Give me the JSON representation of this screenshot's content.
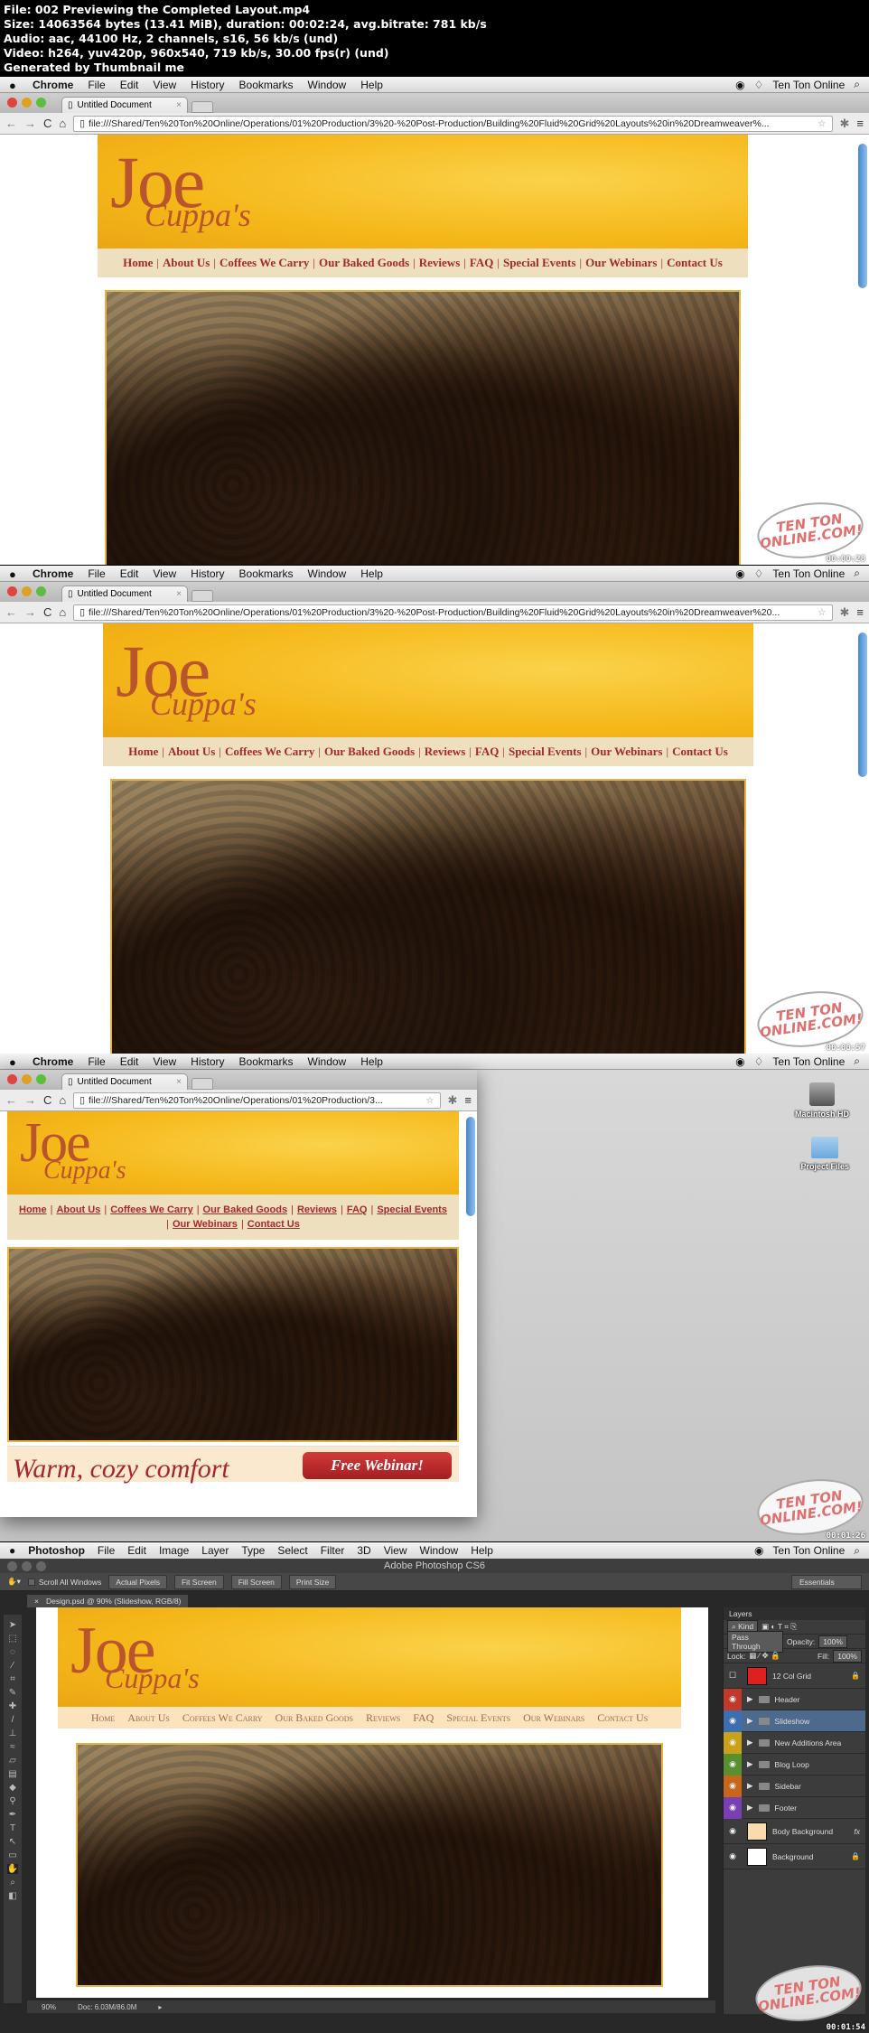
{
  "header": {
    "line1": "File: 002 Previewing the Completed Layout.mp4",
    "line2": "Size: 14063564 bytes (13.41 MiB), duration: 00:02:24, avg.bitrate: 781 kb/s",
    "line3": "Audio: aac, 44100 Hz, 2 channels, s16, 56 kb/s (und)",
    "line4": "Video: h264, yuv420p, 960x540, 719 kb/s, 30.00 fps(r) (und)",
    "line5": "Generated by Thumbnail me"
  },
  "mac_menu": {
    "app": "Chrome",
    "items": [
      "File",
      "Edit",
      "View",
      "History",
      "Bookmarks",
      "Window",
      "Help"
    ],
    "user": "Ten Ton Online"
  },
  "browser": {
    "tab_title": "Untitled Document",
    "tab_close": "×",
    "url_full": "file:///Shared/Ten%20Ton%20Online/Operations/01%20Production/3%20-%20Post-Production/Building%20Fluid%20Grid%20Layouts%20in%20Dreamweaver%...",
    "url_full2": "file:///Shared/Ten%20Ton%20Online/Operations/01%20Production/3%20-%20Post-Production/Building%20Fluid%20Grid%20Layouts%20in%20Dreamweaver%20...",
    "url_short": "file:///Shared/Ten%20Ton%20Online/Operations/01%20Production/3..."
  },
  "site": {
    "logo_main": "Joe",
    "logo_sub": "Cuppa's",
    "nav": [
      "Home",
      "About Us",
      "Coffees We Carry",
      "Our Baked Goods",
      "Reviews",
      "FAQ",
      "Special Events",
      "Our Webinars",
      "Contact Us"
    ],
    "separator": "|",
    "promo_text": "Warm, cozy comfort",
    "promo_button": "Free Webinar!"
  },
  "desktop": {
    "icons": [
      "Macintosh HD",
      "Project Files"
    ]
  },
  "watermark": {
    "line1": "TEN TON",
    "line2": "ONLINE.COM!"
  },
  "timestamps": [
    "00:00:28",
    "00:00:57",
    "00:01:26",
    "00:01:54"
  ],
  "photoshop": {
    "menu_app": "Photoshop",
    "menu_items": [
      "File",
      "Edit",
      "Image",
      "Layer",
      "Type",
      "Select",
      "Filter",
      "3D",
      "View",
      "Window",
      "Help"
    ],
    "window_title": "Adobe Photoshop CS6",
    "options": {
      "scroll_all": "Scroll All Windows",
      "buttons": [
        "Actual Pixels",
        "Fit Screen",
        "Fill Screen",
        "Print Size"
      ],
      "workspace": "Essentials"
    },
    "doc_tab": "Design.psd @ 90% (Slideshow, RGB/8)",
    "status": {
      "zoom": "90%",
      "doc": "Doc: 6.03M/86.0M"
    },
    "layers_panel": {
      "title": "Layers",
      "filter": "Kind",
      "blend_mode": "Pass Through",
      "opacity_label": "Opacity:",
      "opacity": "100%",
      "lock_label": "Lock:",
      "fill_label": "Fill:",
      "fill": "100%",
      "layers": [
        {
          "name": "12 Col Grid",
          "color": "",
          "type": "layer",
          "locked": true
        },
        {
          "name": "Header",
          "color": "#c0392b",
          "type": "group"
        },
        {
          "name": "Slideshow",
          "color": "#3d6fb0",
          "type": "group",
          "selected": true
        },
        {
          "name": "New Additions Area",
          "color": "#c9a21a",
          "type": "group"
        },
        {
          "name": "Blog Loop",
          "color": "#5a8f2e",
          "type": "group"
        },
        {
          "name": "Sidebar",
          "color": "#c8661a",
          "type": "group"
        },
        {
          "name": "Footer",
          "color": "#7b3fb5",
          "type": "group"
        },
        {
          "name": "Body Background",
          "color": "",
          "type": "layer",
          "fx": "fx"
        },
        {
          "name": "Background",
          "color": "",
          "type": "layer",
          "locked": true
        }
      ]
    },
    "nav_caps": [
      "Home",
      "About Us",
      "Coffees We Carry",
      "Our Baked Goods",
      "Reviews",
      "FAQ",
      "Special Events",
      "Our Webinars",
      "Contact Us"
    ]
  }
}
